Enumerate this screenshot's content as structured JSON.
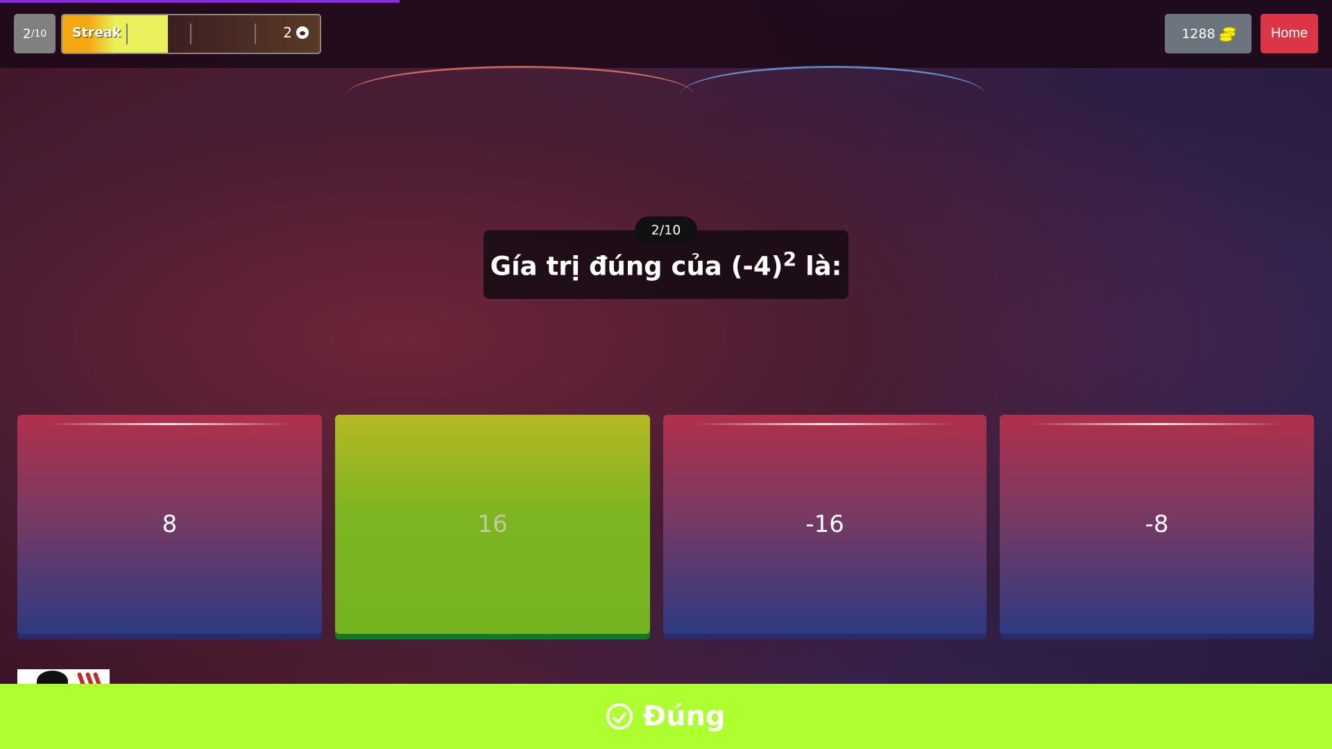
{
  "progress_percent": 30,
  "header": {
    "counter": {
      "current": "2",
      "total": "/10"
    },
    "streak": {
      "label": "Streak",
      "count": "2",
      "fill_percent": 41,
      "icon": "flame-icon"
    },
    "coins": {
      "value": "1288",
      "icon": "coins-icon"
    },
    "home_label": "Home"
  },
  "question": {
    "badge": "2/10",
    "text": "Gía trị đúng của (-4)",
    "superscript": "2",
    "suffix": " là:"
  },
  "answers": [
    {
      "label": "8",
      "state": "normal"
    },
    {
      "label": "16",
      "state": "correct"
    },
    {
      "label": "-16",
      "state": "normal"
    },
    {
      "label": "-8",
      "state": "normal"
    }
  ],
  "result": {
    "label": "Đúng",
    "icon": "check-circle-icon",
    "color": "#adff2f"
  }
}
